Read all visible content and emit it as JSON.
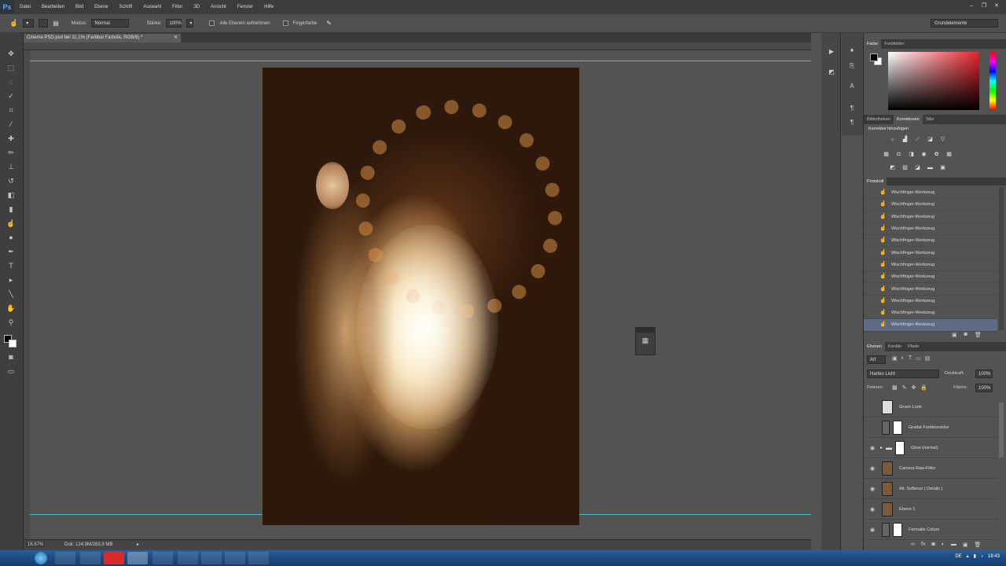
{
  "app": {
    "logo": "Ps"
  },
  "menu": [
    "Datei",
    "Bearbeiten",
    "Bild",
    "Ebene",
    "Schrift",
    "Auswahl",
    "Filter",
    "3D",
    "Ansicht",
    "Fenster",
    "Hilfe"
  ],
  "options": {
    "modus_label": "Modus:",
    "modus_value": "Normal",
    "staerke_label": "Stärke:",
    "staerke_value": "100%",
    "alle_ebenen": "Alle Ebenen aufnehmen",
    "fingerfarbe": "Fingerfarbe",
    "workspace": "Grundelemente"
  },
  "document": {
    "tab_title": "Cinema PSD.psd bei 11,1% (Farbbal Farbsfe, RGB/8) *",
    "zoom": "16,67%",
    "doc_size": "Dok: 124,9M/263,9 MB"
  },
  "color_panel": {
    "tabs": [
      "Farbe",
      "Farbfelder"
    ]
  },
  "adjust_panel": {
    "tabs": [
      "Bibliotheken",
      "Korrekturen",
      "Stile"
    ],
    "title": "Korrektur hinzufügen"
  },
  "history_panel": {
    "title": "Protokoll",
    "items": [
      "Wischfinger-Werkzeug",
      "Wischfinger-Werkzeug",
      "Wischfinger-Werkzeug",
      "Wischfinger-Werkzeug",
      "Wischfinger-Werkzeug",
      "Wischfinger-Werkzeug",
      "Wischfinger-Werkzeug",
      "Wischfinger-Werkzeug",
      "Wischfinger-Werkzeug",
      "Wischfinger-Werkzeug",
      "Wischfinger-Werkzeug",
      "Wischfinger-Werkzeug"
    ]
  },
  "layers_panel": {
    "tabs": [
      "Ebenen",
      "Kanäle",
      "Pfade"
    ],
    "kind": "Art",
    "blend": "Hartes Licht",
    "deckkraft_label": "Deckkraft:",
    "deckkraft": "100%",
    "fixieren_label": "Fixieren:",
    "flaeche_label": "Fläche:",
    "flaeche": "100%",
    "layers": [
      {
        "name": "Gruen Look",
        "visible": false
      },
      {
        "name": "Gradat Farbkorrektur",
        "visible": false
      },
      {
        "name": "Glow (normal)",
        "visible": true
      },
      {
        "name": "Camera Raw-Filter",
        "visible": true
      },
      {
        "name": "Alt: Softerun ( Details )",
        "visible": true
      },
      {
        "name": "Ebene 1",
        "visible": true
      },
      {
        "name": "Formatie Colure",
        "visible": true
      }
    ]
  },
  "taskbar": {
    "lang": "DE",
    "time": "18:43"
  }
}
